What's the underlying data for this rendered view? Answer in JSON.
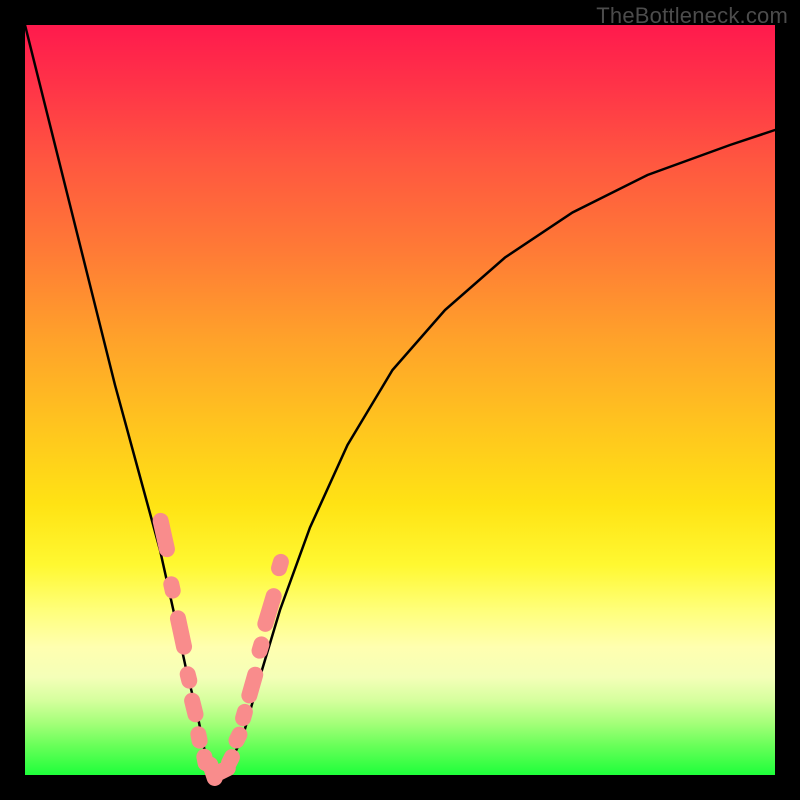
{
  "watermark": "TheBottleneck.com",
  "chart_data": {
    "type": "line",
    "title": "",
    "xlabel": "",
    "ylabel": "",
    "xlim": [
      0,
      100
    ],
    "ylim": [
      0,
      100
    ],
    "grid": false,
    "legend": false,
    "series": [
      {
        "name": "curve",
        "color": "#000000",
        "x": [
          0,
          3,
          6,
          9,
          12,
          15,
          18,
          20,
          21.5,
          23,
          24,
          25,
          27,
          29,
          31,
          34,
          38,
          43,
          49,
          56,
          64,
          73,
          83,
          94,
          100
        ],
        "y": [
          100,
          88,
          76,
          64,
          52,
          41,
          30,
          21,
          14,
          8,
          3,
          0,
          1,
          5,
          12,
          22,
          33,
          44,
          54,
          62,
          69,
          75,
          80,
          84,
          86
        ]
      }
    ],
    "markers": {
      "name": "pink-rounded-markers",
      "color": "#f98c8c",
      "points": [
        {
          "x": 18.5,
          "y": 32,
          "len": 6
        },
        {
          "x": 19.6,
          "y": 25,
          "len": 3
        },
        {
          "x": 20.8,
          "y": 19,
          "len": 6
        },
        {
          "x": 21.8,
          "y": 13,
          "len": 3
        },
        {
          "x": 22.5,
          "y": 9,
          "len": 4
        },
        {
          "x": 23.2,
          "y": 5,
          "len": 3
        },
        {
          "x": 24.0,
          "y": 2,
          "len": 3
        },
        {
          "x": 25.0,
          "y": 0.5,
          "len": 4
        },
        {
          "x": 26.2,
          "y": 0.5,
          "len": 4
        },
        {
          "x": 27.4,
          "y": 2,
          "len": 3
        },
        {
          "x": 28.4,
          "y": 5,
          "len": 3
        },
        {
          "x": 29.2,
          "y": 8,
          "len": 3
        },
        {
          "x": 30.3,
          "y": 12,
          "len": 5
        },
        {
          "x": 31.4,
          "y": 17,
          "len": 3
        },
        {
          "x": 32.6,
          "y": 22,
          "len": 6
        },
        {
          "x": 34.0,
          "y": 28,
          "len": 3
        }
      ]
    }
  }
}
